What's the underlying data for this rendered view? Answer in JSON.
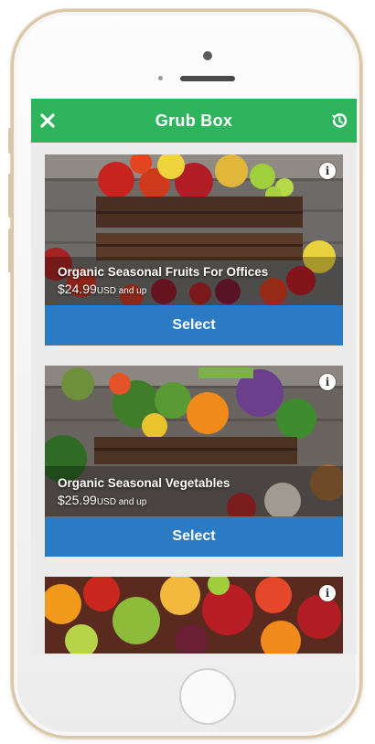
{
  "app": {
    "title": "Grub Box",
    "bar_color": "#2db45c",
    "close_icon": "close-icon",
    "history_icon": "history-icon"
  },
  "products": [
    {
      "title": "Organic Seasonal Fruits For Offices",
      "price": "$24.99",
      "price_suffix": "USD and up",
      "button_label": "Select",
      "info_label": "i"
    },
    {
      "title": "Organic Seasonal Vegetables",
      "price": "$25.99",
      "price_suffix": "USD and up",
      "button_label": "Select",
      "info_label": "i"
    },
    {
      "title": "",
      "info_label": "i"
    }
  ],
  "colors": {
    "accent": "#2a7bc4",
    "green": "#2db45c"
  }
}
